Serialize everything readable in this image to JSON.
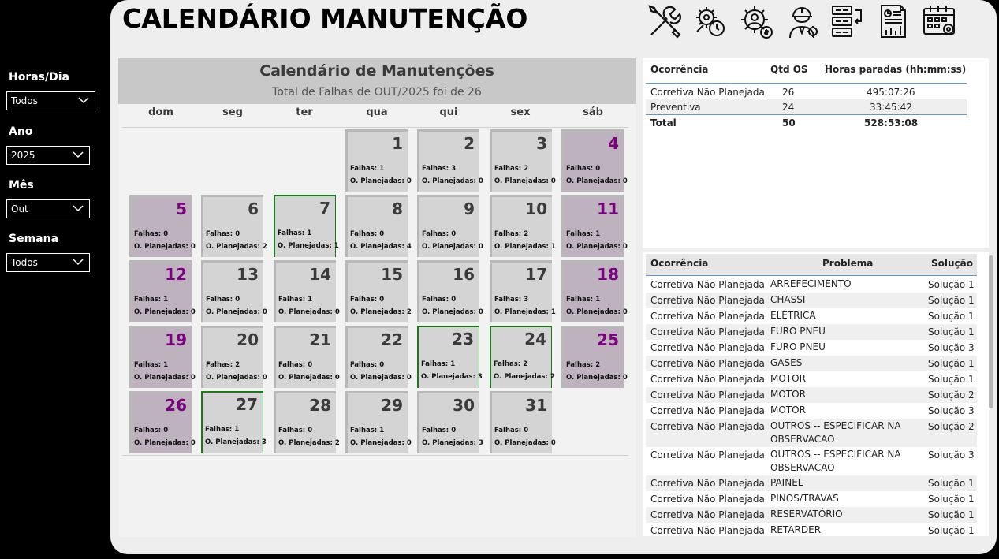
{
  "page": {
    "title": "CALENDÁRIO MANUTENÇÃO"
  },
  "header_icons": [
    "tools-icon",
    "maintenance-clock-icon",
    "gear-money-icon",
    "engineer-icon",
    "list-transfer-icon",
    "report-chart-icon",
    "calendar-gear-icon"
  ],
  "filters": [
    {
      "label": "Horas/Dia",
      "value": "Todos"
    },
    {
      "label": "Ano",
      "value": "2025"
    },
    {
      "label": "Mês",
      "value": "Out"
    },
    {
      "label": "Semana",
      "value": "Todos"
    }
  ],
  "calendar": {
    "title": "Calendário de Manutenções",
    "subtitle": "Total de Falhas de OUT/2025 foi de 26",
    "weekdays": [
      "dom",
      "seg",
      "ter",
      "qua",
      "qui",
      "sex",
      "sáb"
    ],
    "falhas_label": "Falhas:",
    "planejadas_label": "O. Planejadas:",
    "days": [
      {
        "d": "1",
        "col": 3,
        "row": 0,
        "f": "1",
        "p": "0",
        "we": false,
        "green": false
      },
      {
        "d": "2",
        "col": 4,
        "row": 0,
        "f": "3",
        "p": "0",
        "we": false,
        "green": false
      },
      {
        "d": "3",
        "col": 5,
        "row": 0,
        "f": "2",
        "p": "0",
        "we": false,
        "green": false
      },
      {
        "d": "4",
        "col": 6,
        "row": 0,
        "f": "0",
        "p": "0",
        "we": true,
        "green": false
      },
      {
        "d": "5",
        "col": 0,
        "row": 1,
        "f": "0",
        "p": "0",
        "we": true,
        "green": false
      },
      {
        "d": "6",
        "col": 1,
        "row": 1,
        "f": "0",
        "p": "2",
        "we": false,
        "green": false
      },
      {
        "d": "7",
        "col": 2,
        "row": 1,
        "f": "1",
        "p": "1",
        "we": false,
        "green": true
      },
      {
        "d": "8",
        "col": 3,
        "row": 1,
        "f": "0",
        "p": "4",
        "we": false,
        "green": false
      },
      {
        "d": "9",
        "col": 4,
        "row": 1,
        "f": "0",
        "p": "0",
        "we": false,
        "green": false
      },
      {
        "d": "10",
        "col": 5,
        "row": 1,
        "f": "2",
        "p": "1",
        "we": false,
        "green": false
      },
      {
        "d": "11",
        "col": 6,
        "row": 1,
        "f": "1",
        "p": "0",
        "we": true,
        "green": false
      },
      {
        "d": "12",
        "col": 0,
        "row": 2,
        "f": "1",
        "p": "0",
        "we": true,
        "green": false
      },
      {
        "d": "13",
        "col": 1,
        "row": 2,
        "f": "0",
        "p": "0",
        "we": false,
        "green": false
      },
      {
        "d": "14",
        "col": 2,
        "row": 2,
        "f": "1",
        "p": "0",
        "we": false,
        "green": false
      },
      {
        "d": "15",
        "col": 3,
        "row": 2,
        "f": "0",
        "p": "2",
        "we": false,
        "green": false
      },
      {
        "d": "16",
        "col": 4,
        "row": 2,
        "f": "0",
        "p": "0",
        "we": false,
        "green": false
      },
      {
        "d": "17",
        "col": 5,
        "row": 2,
        "f": "3",
        "p": "1",
        "we": false,
        "green": false
      },
      {
        "d": "18",
        "col": 6,
        "row": 2,
        "f": "1",
        "p": "0",
        "we": true,
        "green": false
      },
      {
        "d": "19",
        "col": 0,
        "row": 3,
        "f": "1",
        "p": "0",
        "we": true,
        "green": false
      },
      {
        "d": "20",
        "col": 1,
        "row": 3,
        "f": "2",
        "p": "0",
        "we": false,
        "green": false
      },
      {
        "d": "21",
        "col": 2,
        "row": 3,
        "f": "0",
        "p": "0",
        "we": false,
        "green": false
      },
      {
        "d": "22",
        "col": 3,
        "row": 3,
        "f": "0",
        "p": "0",
        "we": false,
        "green": false
      },
      {
        "d": "23",
        "col": 4,
        "row": 3,
        "f": "1",
        "p": "3",
        "we": false,
        "green": true
      },
      {
        "d": "24",
        "col": 5,
        "row": 3,
        "f": "2",
        "p": "2",
        "we": false,
        "green": true
      },
      {
        "d": "25",
        "col": 6,
        "row": 3,
        "f": "2",
        "p": "0",
        "we": true,
        "green": false
      },
      {
        "d": "26",
        "col": 0,
        "row": 4,
        "f": "0",
        "p": "0",
        "we": true,
        "green": false
      },
      {
        "d": "27",
        "col": 1,
        "row": 4,
        "f": "1",
        "p": "3",
        "we": false,
        "green": true
      },
      {
        "d": "28",
        "col": 2,
        "row": 4,
        "f": "0",
        "p": "2",
        "we": false,
        "green": false
      },
      {
        "d": "29",
        "col": 3,
        "row": 4,
        "f": "1",
        "p": "0",
        "we": false,
        "green": false
      },
      {
        "d": "30",
        "col": 4,
        "row": 4,
        "f": "0",
        "p": "3",
        "we": false,
        "green": false
      },
      {
        "d": "31",
        "col": 5,
        "row": 4,
        "f": "0",
        "p": "0",
        "we": false,
        "green": false
      }
    ]
  },
  "summary_table": {
    "headers": [
      "Ocorrência",
      "Qtd OS",
      "Horas paradas (hh:mm:ss)"
    ],
    "rows": [
      [
        "Corretiva Não Planejada",
        "26",
        "495:07:26"
      ],
      [
        "Preventiva",
        "24",
        "33:45:42"
      ]
    ],
    "total": [
      "Total",
      "50",
      "528:53:08"
    ]
  },
  "problem_table": {
    "headers": [
      "Ocorrência",
      "Problema",
      "Solução"
    ],
    "rows": [
      [
        "Corretiva Não Planejada",
        "ARREFECIMENTO",
        "Solução 1"
      ],
      [
        "Corretiva Não Planejada",
        "CHASSI",
        "Solução 1"
      ],
      [
        "Corretiva Não Planejada",
        "ELÉTRICA",
        "Solução 1"
      ],
      [
        "Corretiva Não Planejada",
        "FURO PNEU",
        "Solução 1"
      ],
      [
        "Corretiva Não Planejada",
        "FURO PNEU",
        "Solução 3"
      ],
      [
        "Corretiva Não Planejada",
        "GASES",
        "Solução 1"
      ],
      [
        "Corretiva Não Planejada",
        "MOTOR",
        "Solução 1"
      ],
      [
        "Corretiva Não Planejada",
        "MOTOR",
        "Solução 2"
      ],
      [
        "Corretiva Não Planejada",
        "MOTOR",
        "Solução 3"
      ],
      [
        "Corretiva Não Planejada",
        "OUTROS -- ESPECIFICAR NA OBSERVACAO",
        "Solução 2"
      ],
      [
        "Corretiva Não Planejada",
        "OUTROS -- ESPECIFICAR NA OBSERVACAO",
        "Solução 3"
      ],
      [
        "Corretiva Não Planejada",
        "PAINEL",
        "Solução 1"
      ],
      [
        "Corretiva Não Planejada",
        "PINOS/TRAVAS",
        "Solução 1"
      ],
      [
        "Corretiva Não Planejada",
        "RESERVATÓRIO",
        "Solução 1"
      ],
      [
        "Corretiva Não Planejada",
        "RETARDER",
        "Solução 1"
      ]
    ]
  },
  "colors": {
    "weekend_day": "#bdb2bd",
    "weekend_number": "#7a0080",
    "highlight_border": "#1a7a1a",
    "table_rule": "#5b9bd5"
  }
}
